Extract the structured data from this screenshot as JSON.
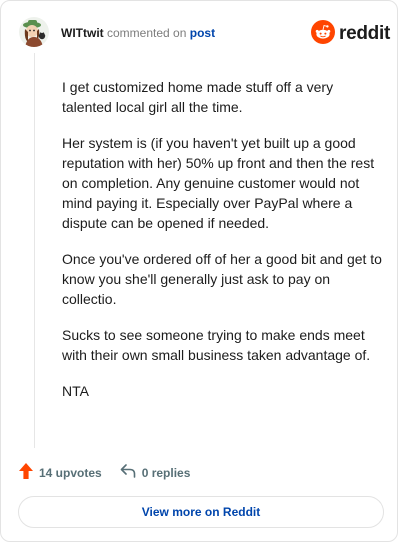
{
  "header": {
    "username": "WITtwit",
    "action_text": "commented on",
    "post_link": "post"
  },
  "brand": {
    "logo_text": "reddit",
    "logo_icon": "reddit-alien-icon",
    "accent_color": "#ff4500"
  },
  "comment": {
    "paragraphs": [
      "I get customized home made stuff off a very talented local girl all the time.",
      "Her system is (if you haven't yet built up a good reputation with her) 50% up front and then the rest on completion. Any genuine customer would not mind paying it. Especially over PayPal where a dispute can be opened if needed.",
      "Once you've ordered off of her a good bit and get to know you she'll generally just ask to pay on collectio.",
      "Sucks to see someone trying to make ends meet with their own small business taken advantage of.",
      "NTA"
    ]
  },
  "actions": {
    "upvotes_label": "14 upvotes",
    "upvote_icon": "upvote-arrow-icon",
    "replies_label": "0 replies",
    "reply_icon": "reply-arrow-icon"
  },
  "footer": {
    "view_more_label": "View more on Reddit",
    "link_color": "#0045ac"
  }
}
